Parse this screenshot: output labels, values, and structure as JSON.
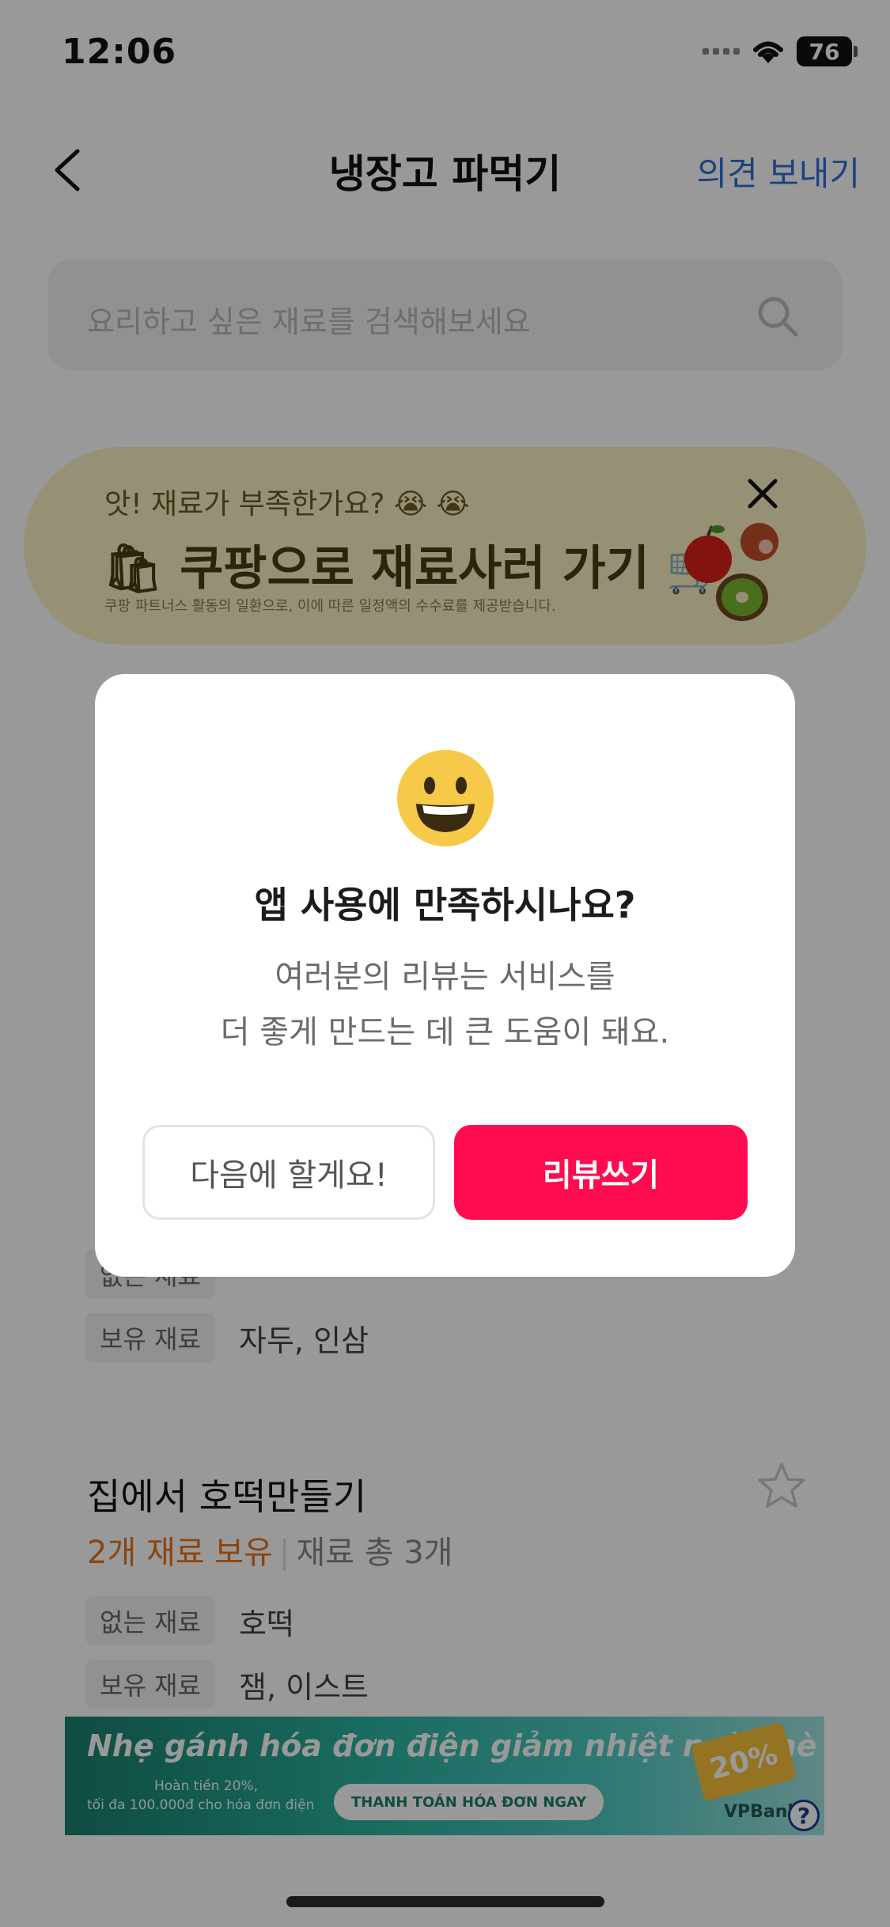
{
  "status_bar": {
    "time": "12:06",
    "battery": "76"
  },
  "nav": {
    "title": "냉장고 파먹기",
    "feedback_label": "의견 보내기"
  },
  "search": {
    "placeholder": "요리하고 싶은 재료를 검색해보세요"
  },
  "banner": {
    "subtitle": "앗! 재료가 부족한가요? 😭 😭",
    "title": "쿠팡으로 재료사러 가기",
    "disclaimer": "쿠팡 파트너스 활동의 일환으로, 이에 따른 일정액의 수수료를 제공받습니다."
  },
  "recipes": [
    {
      "title": "집에서 호떡만들기",
      "owned": "2개 재료 보유",
      "total": "재료 총 3개",
      "missing_label": "없는 재료",
      "missing_value": "호떡",
      "have_label": "보유 재료",
      "have_value": "잼, 이스트"
    }
  ],
  "partial_card": {
    "have_label": "보유 재료",
    "have_value": "자두, 인삼",
    "missing_label": "없는 재료"
  },
  "ad": {
    "headline": "Nhẹ gánh hóa đơn điện  giảm nhiệt ngày hè",
    "line2": "Hoàn tiền 20%,",
    "line3": "tối đa 100.000đ cho hóa đơn điện",
    "cta": "THANH TOÁN HÓA ĐƠN NGAY",
    "badge": "20%",
    "brand": "VPBank",
    "help": "?"
  },
  "modal": {
    "title": "앱 사용에 만족하시나요?",
    "message_line1": "여러분의 리뷰는 서비스를",
    "message_line2": "더 좋게 만드는 데 큰 도움이 돼요.",
    "later_label": "다음에 할게요!",
    "review_label": "리뷰쓰기"
  },
  "colors": {
    "accent_pink": "#ff0b4f",
    "owned_orange": "#e8731a",
    "link_blue": "#2f6fd6"
  }
}
